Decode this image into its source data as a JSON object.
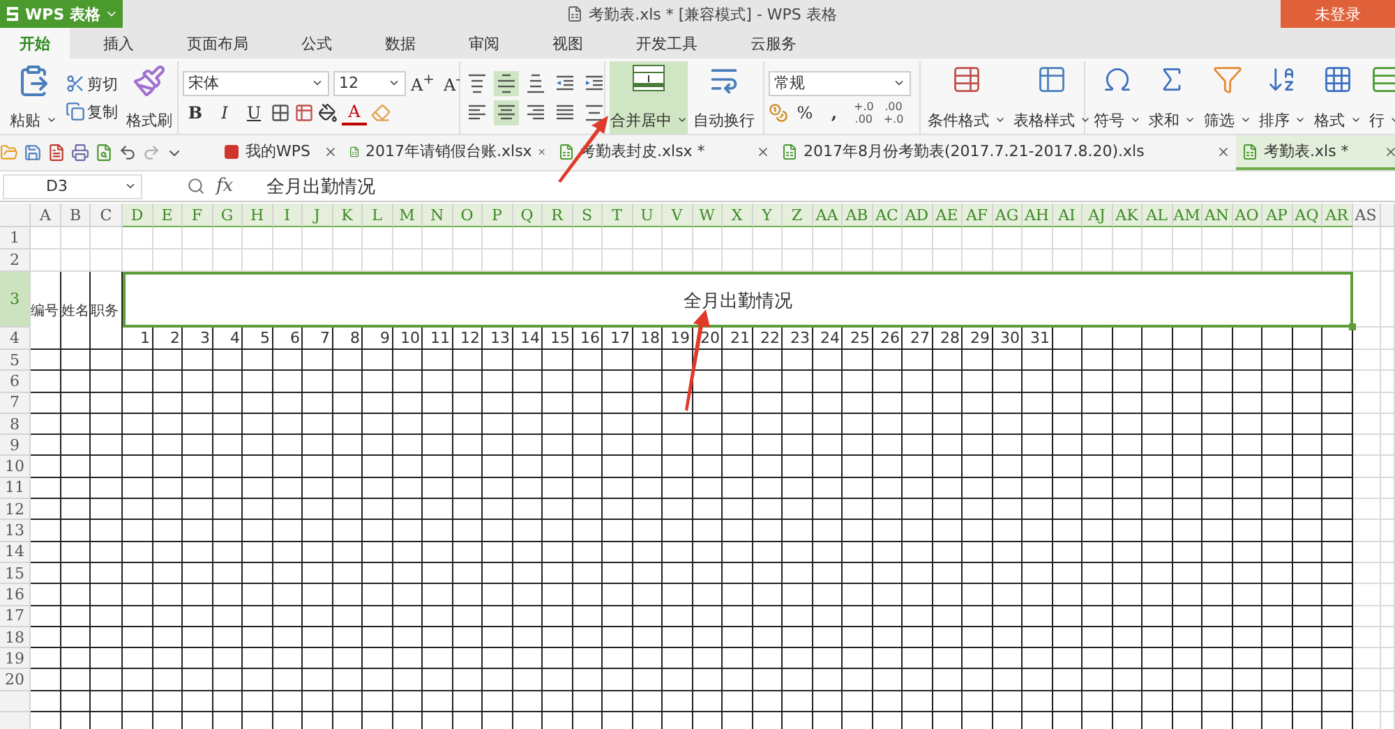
{
  "title_bar": {
    "app_button": "WPS 表格",
    "document_title": "考勤表.xls * [兼容模式] - WPS 表格",
    "login_button": "未登录"
  },
  "ribbon_tabs": [
    {
      "label": "开始",
      "selected": true
    },
    {
      "label": "插入",
      "selected": false
    },
    {
      "label": "页面布局",
      "selected": false
    },
    {
      "label": "公式",
      "selected": false
    },
    {
      "label": "数据",
      "selected": false
    },
    {
      "label": "审阅",
      "selected": false
    },
    {
      "label": "视图",
      "selected": false
    },
    {
      "label": "开发工具",
      "selected": false
    },
    {
      "label": "云服务",
      "selected": false
    }
  ],
  "clipboard": {
    "paste": "粘贴",
    "cut": "剪切",
    "copy": "复制",
    "format_painter": "格式刷"
  },
  "font": {
    "name": "宋体",
    "size": "12",
    "grow": "A$^{+}$",
    "shrink": "A$^{-}$",
    "bold": "B",
    "italic": "I",
    "underline": "U",
    "font_color": "A"
  },
  "alignment": [
    {
      "kind": "top",
      "selected": false
    },
    {
      "kind": "middle",
      "selected": true
    },
    {
      "kind": "bottom",
      "selected": false
    },
    {
      "kind": "outdent",
      "selected": false
    },
    {
      "kind": "indent",
      "selected": false
    },
    {
      "kind": "left",
      "selected": false
    },
    {
      "kind": "center",
      "selected": true
    },
    {
      "kind": "right",
      "selected": false
    },
    {
      "kind": "justify",
      "selected": false
    },
    {
      "kind": "distributed",
      "selected": false
    }
  ],
  "merge_button": {
    "label": "合并居中",
    "selected": true
  },
  "wrap_button": {
    "label": "自动换行",
    "selected": false
  },
  "number": {
    "format": "常规",
    "percent": "%",
    "comma": ",",
    "decimals": [
      {
        "top": "+.0",
        "bottom": ".00"
      },
      {
        "top": ".00",
        "bottom": "+.0"
      }
    ]
  },
  "tools": [
    {
      "label": "条件格式",
      "kind": "conditional"
    },
    {
      "label": "表格样式",
      "kind": "table_style"
    },
    {
      "label": "符号",
      "kind": "symbol"
    },
    {
      "label": "求和",
      "kind": "sum"
    },
    {
      "label": "筛选",
      "kind": "filter"
    },
    {
      "label": "排序",
      "kind": "sort"
    },
    {
      "label": "格式",
      "kind": "format"
    },
    {
      "label": "行",
      "kind": "rows"
    }
  ],
  "document_tabs": [
    {
      "label": "我的WPS",
      "kind": "home",
      "selected": false
    },
    {
      "label": "2017年请销假台账.xlsx",
      "kind": "sheet",
      "selected": false
    },
    {
      "label": "考勤表封皮.xlsx *",
      "kind": "sheet",
      "selected": false
    },
    {
      "label": "2017年8月份考勤表(2017.7.21-2017.8.20).xls",
      "kind": "sheet",
      "selected": false
    },
    {
      "label": "考勤表.xls *",
      "kind": "sheet",
      "selected": true
    }
  ],
  "formula_bar": {
    "cell_reference": "D3",
    "function_label": "fx",
    "value": "全月出勤情况"
  },
  "sheet": {
    "columns": [
      {
        "label": "A",
        "selected": false
      },
      {
        "label": "B",
        "selected": false
      },
      {
        "label": "C",
        "selected": false
      },
      {
        "label": "D",
        "selected": true
      },
      {
        "label": "E",
        "selected": true
      },
      {
        "label": "F",
        "selected": true
      },
      {
        "label": "G",
        "selected": true
      },
      {
        "label": "H",
        "selected": true
      },
      {
        "label": "I",
        "selected": true
      },
      {
        "label": "J",
        "selected": true
      },
      {
        "label": "K",
        "selected": true
      },
      {
        "label": "L",
        "selected": true
      },
      {
        "label": "M",
        "selected": true
      },
      {
        "label": "N",
        "selected": true
      },
      {
        "label": "O",
        "selected": true
      },
      {
        "label": "P",
        "selected": true
      },
      {
        "label": "Q",
        "selected": true
      },
      {
        "label": "R",
        "selected": true
      },
      {
        "label": "S",
        "selected": true
      },
      {
        "label": "T",
        "selected": true
      },
      {
        "label": "U",
        "selected": true
      },
      {
        "label": "V",
        "selected": true
      },
      {
        "label": "W",
        "selected": true
      },
      {
        "label": "X",
        "selected": true
      },
      {
        "label": "Y",
        "selected": true
      },
      {
        "label": "Z",
        "selected": true
      },
      {
        "label": "AA",
        "selected": true
      },
      {
        "label": "AB",
        "selected": true
      },
      {
        "label": "AC",
        "selected": true
      },
      {
        "label": "AD",
        "selected": true
      },
      {
        "label": "AE",
        "selected": true
      },
      {
        "label": "AF",
        "selected": true
      },
      {
        "label": "AG",
        "selected": true
      },
      {
        "label": "AH",
        "selected": true
      },
      {
        "label": "AI",
        "selected": true
      },
      {
        "label": "AJ",
        "selected": true
      },
      {
        "label": "AK",
        "selected": true
      },
      {
        "label": "AL",
        "selected": true
      },
      {
        "label": "AM",
        "selected": true
      },
      {
        "label": "AN",
        "selected": true
      },
      {
        "label": "AO",
        "selected": true
      },
      {
        "label": "AP",
        "selected": true
      },
      {
        "label": "AQ",
        "selected": true
      },
      {
        "label": "AR",
        "selected": true
      },
      {
        "label": "AS",
        "selected": false
      }
    ],
    "rows": [
      {
        "label": "1",
        "selected": false
      },
      {
        "label": "2",
        "selected": false
      },
      {
        "label": "3",
        "selected": true
      },
      {
        "label": "4",
        "selected": false
      },
      {
        "label": "5",
        "selected": false
      },
      {
        "label": "6",
        "selected": false
      },
      {
        "label": "7",
        "selected": false
      },
      {
        "label": "8",
        "selected": false
      },
      {
        "label": "9",
        "selected": false
      },
      {
        "label": "10",
        "selected": false
      },
      {
        "label": "11",
        "selected": false
      },
      {
        "label": "12",
        "selected": false
      },
      {
        "label": "13",
        "selected": false
      },
      {
        "label": "14",
        "selected": false
      },
      {
        "label": "15",
        "selected": false
      },
      {
        "label": "16",
        "selected": false
      },
      {
        "label": "17",
        "selected": false
      },
      {
        "label": "18",
        "selected": false
      },
      {
        "label": "19",
        "selected": false
      },
      {
        "label": "20",
        "selected": false
      }
    ],
    "header_cells": [
      "编号",
      "姓名",
      "职务"
    ],
    "merged_title": "全月出勤情况",
    "day_numbers": [
      "1",
      "2",
      "3",
      "4",
      "5",
      "6",
      "7",
      "8",
      "9",
      "10",
      "11",
      "12",
      "13",
      "14",
      "15",
      "16",
      "17",
      "18",
      "19",
      "20",
      "21",
      "22",
      "23",
      "24",
      "25",
      "26",
      "27",
      "28",
      "29",
      "30",
      "31"
    ]
  }
}
